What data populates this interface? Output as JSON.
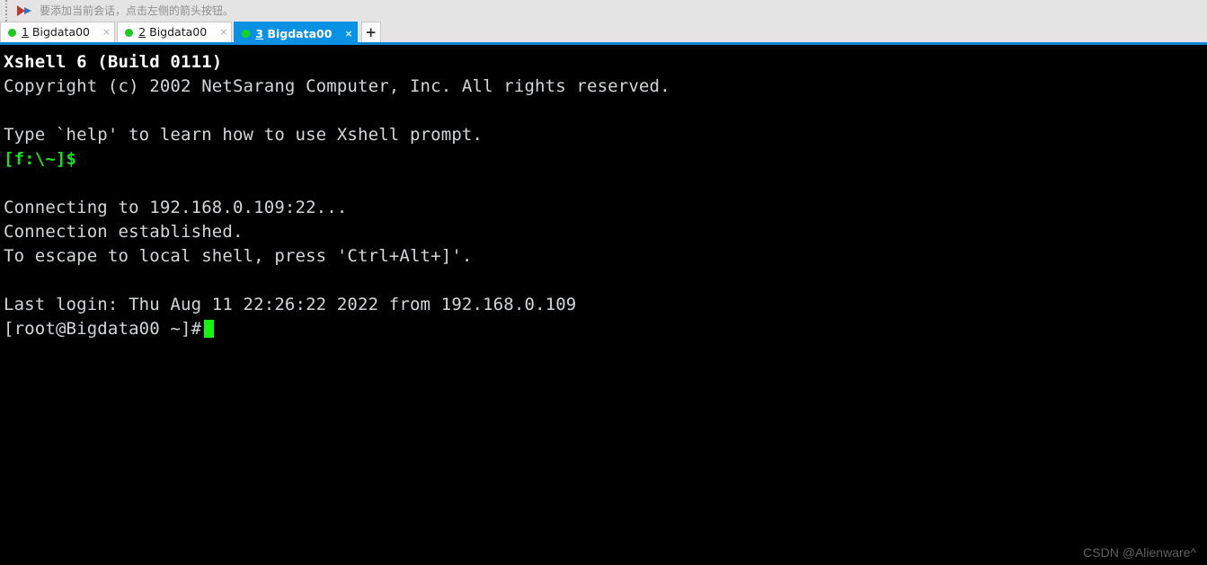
{
  "hint_bar": {
    "icon": "red-blue-arrow-icon",
    "message": "要添加当前会话，点击左侧的箭头按钮。",
    "grip": "drag-handle-icon"
  },
  "tabs": {
    "items": [
      {
        "index": "1",
        "label": " Bigdata00",
        "status_dot": "green-connected-dot",
        "close": "×",
        "active": false
      },
      {
        "index": "2",
        "label": " Bigdata00",
        "status_dot": "green-connected-dot",
        "close": "×",
        "active": false
      },
      {
        "index": "3",
        "label": " Bigdata00",
        "status_dot": "green-connected-dot",
        "close": "×",
        "active": true
      }
    ],
    "new_tab_label": "+",
    "active_tab_color": "#0b91e3",
    "underline_color": "#0b84d6",
    "dot_color": "#1ec81e"
  },
  "terminal": {
    "background": "#000000",
    "foreground": "#d3d7da",
    "prompt_color": "#19e019",
    "cursor_color": "#12f712",
    "lines": [
      {
        "text": "Xshell 6 (Build 0111)",
        "style": "bold-white"
      },
      {
        "text": "Copyright (c) 2002 NetSarang Computer, Inc. All rights reserved.",
        "style": "normal"
      },
      {
        "text": "",
        "style": "blank"
      },
      {
        "text": "Type `help' to learn how to use Xshell prompt.",
        "style": "normal"
      },
      {
        "text": "[f:\\~]$",
        "style": "green"
      },
      {
        "text": "",
        "style": "blank"
      },
      {
        "text": "Connecting to 192.168.0.109:22...",
        "style": "normal"
      },
      {
        "text": "Connection established.",
        "style": "normal"
      },
      {
        "text": "To escape to local shell, press 'Ctrl+Alt+]'.",
        "style": "normal"
      },
      {
        "text": "",
        "style": "blank"
      },
      {
        "text": "Last login: Thu Aug 11 22:26:22 2022 from 192.168.0.109",
        "style": "normal"
      },
      {
        "text": "[root@Bigdata00 ~]#",
        "style": "cursor-line"
      }
    ]
  },
  "watermark": {
    "text": "CSDN @Alienware^"
  }
}
